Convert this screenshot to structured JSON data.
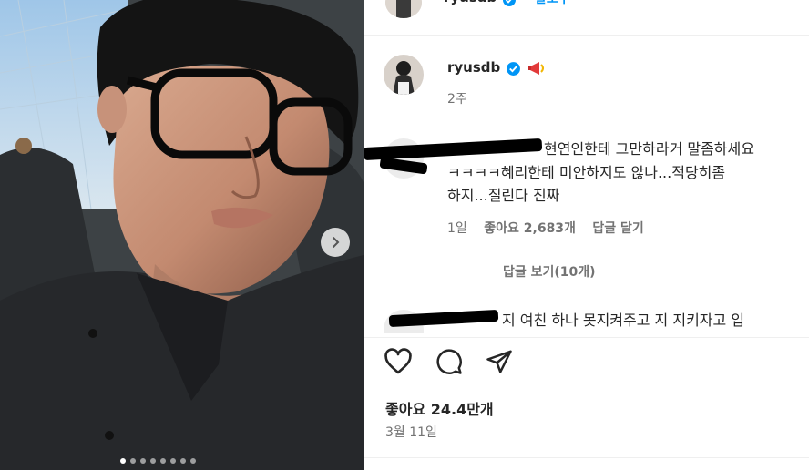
{
  "header": {
    "username": "ryusdb",
    "follow_label": "팔로우"
  },
  "caption": {
    "username": "ryusdb",
    "time_ago": "2주"
  },
  "comments": [
    {
      "text_line1": "현연인한테 그만하라거 말좀하세요",
      "text_line2": "ㅋㅋㅋㅋ혜리한테 미안하지도 않나...적당히좀",
      "text_line3": "하지...질린다 진짜",
      "time": "1일",
      "likes": "좋아요 2,683개",
      "reply_label": "답글 달기",
      "view_replies": "답글 보기(10개)"
    },
    {
      "text_line1": "지 여친 하나 못지켜주고 지 지키자고 입"
    }
  ],
  "actions": {
    "like_icon": "heart-icon",
    "comment_icon": "comment-icon",
    "share_icon": "paper-plane-icon"
  },
  "post": {
    "likes": "좋아요 24.4만개",
    "date": "3월 11일"
  },
  "carousel": {
    "total_dots": 8,
    "active_index": 0
  },
  "colors": {
    "verified": "#0095f6",
    "link": "#0095f6"
  }
}
